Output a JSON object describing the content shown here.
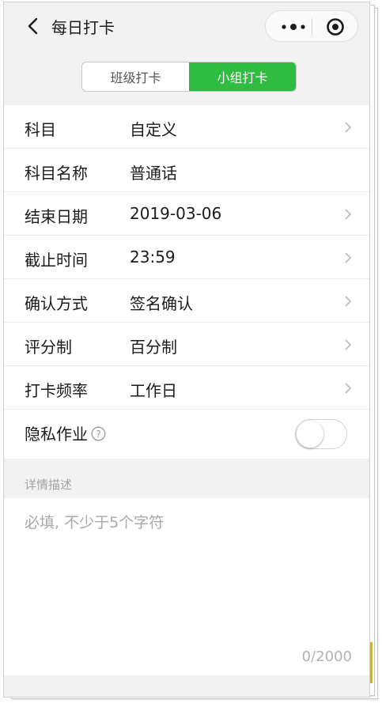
{
  "nav": {
    "title": "每日打卡"
  },
  "segment": {
    "tabs": [
      "班级打卡",
      "小组打卡"
    ],
    "active_index": 1,
    "active_color": "#2ebd41"
  },
  "form": {
    "rows": [
      {
        "label": "科目",
        "value": "自定义",
        "chevron": true
      },
      {
        "label": "科目名称",
        "value": "普通话",
        "chevron": false
      },
      {
        "label": "结束日期",
        "value": "2019-03-06",
        "chevron": true
      },
      {
        "label": "截止时间",
        "value": "23:59",
        "chevron": true
      },
      {
        "label": "确认方式",
        "value": "签名确认",
        "chevron": true
      },
      {
        "label": "评分制",
        "value": "百分制",
        "chevron": true
      },
      {
        "label": "打卡频率",
        "value": "工作日",
        "chevron": true
      }
    ],
    "privacy": {
      "label": "隐私作业",
      "help_icon": "question-circle-icon",
      "toggle_on": false
    }
  },
  "details": {
    "section_title": "详情描述",
    "placeholder": "必填, 不少于5个字符",
    "char_count": "0/2000"
  }
}
